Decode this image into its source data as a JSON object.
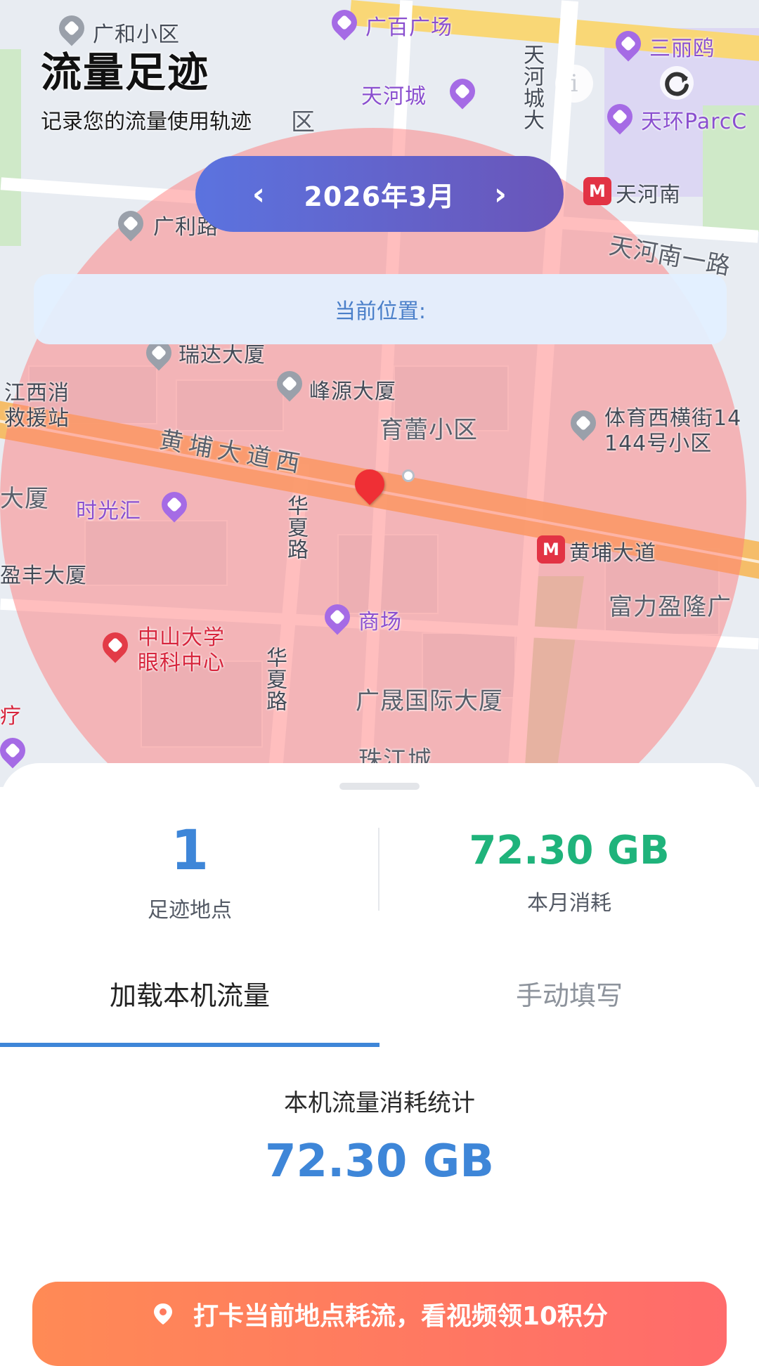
{
  "header": {
    "title": "流量足迹",
    "subtitle": "记录您的流量使用轨迹"
  },
  "month_selector": {
    "prev": "‹",
    "label": "2026年3月",
    "next": "›"
  },
  "location_bar": {
    "label": "当前位置:"
  },
  "map": {
    "labels": [
      "广和小区",
      "广百广场",
      "三丽鸥",
      "天河城",
      "天环ParcC",
      "天河南",
      "天河南一路",
      "广利路",
      "瑞达大厦",
      "峰源大厦",
      "江西消",
      "救援站",
      "育蕾小区",
      "体育西横街14",
      "144号小区",
      "黄埔大道西",
      "时光汇",
      "黄埔大道",
      "盈丰大厦",
      "商场",
      "富力盈隆广",
      "中山大学",
      "眼科中心",
      "广晟国际大厦",
      "珠江城",
      "华夏路",
      "华夏路",
      "天河城大",
      "大厦",
      "区",
      "疗"
    ],
    "colors": {
      "circle": "#ff7878",
      "marker": "#ef2f35"
    }
  },
  "stats": {
    "footprints_value": "1",
    "footprints_label": "足迹地点",
    "monthly_value": "72.30 GB",
    "monthly_label": "本月消耗"
  },
  "tabs": [
    {
      "label": "加载本机流量",
      "active": true
    },
    {
      "label": "手动填写",
      "active": false
    }
  ],
  "usage": {
    "title": "本机流量消耗统计",
    "value": "72.30 GB"
  },
  "checkin": {
    "label": "打卡当前地点耗流，看视频领10积分"
  },
  "icons": {
    "info": "info-icon",
    "refresh": "refresh-icon",
    "location_pin": "location-pin-icon"
  },
  "theme": {
    "primary_blue": "#3e86d8",
    "green": "#1fb37b",
    "gradient_start": "#5b73df",
    "gradient_end": "#6a55b9",
    "button_start": "#ff8a55",
    "button_end": "#ff6b6b"
  }
}
